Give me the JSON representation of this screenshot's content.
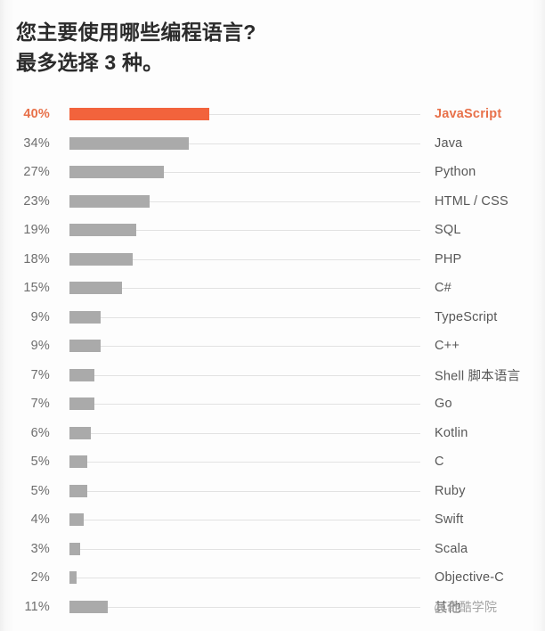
{
  "title": {
    "line1": "您主要使用哪些编程语言?",
    "line2": "最多选择 3 种。"
  },
  "watermark": {
    "text": "@奇酷学院"
  },
  "colors": {
    "highlight": "#f2633c",
    "highlight_text": "#e8714a",
    "bar": "#aaaaaa",
    "track": "#e2e2e2",
    "label": "#575757",
    "pct": "#6e6e6e",
    "title": "#2b2b2b",
    "background": "#fdfdfd"
  },
  "chart_data": {
    "type": "bar",
    "orientation": "horizontal",
    "title": "您主要使用哪些编程语言?最多选择 3 种。",
    "xlabel": "",
    "ylabel": "",
    "xlim": [
      0,
      100
    ],
    "grid": false,
    "legend": null,
    "value_suffix": "%",
    "highlight_category": "JavaScript",
    "categories": [
      "JavaScript",
      "Java",
      "Python",
      "HTML / CSS",
      "SQL",
      "PHP",
      "C#",
      "TypeScript",
      "C++",
      "Shell 脚本语言",
      "Go",
      "Kotlin",
      "C",
      "Ruby",
      "Swift",
      "Scala",
      "Objective-C",
      "其他"
    ],
    "values": [
      40,
      34,
      27,
      23,
      19,
      18,
      15,
      9,
      9,
      7,
      7,
      6,
      5,
      5,
      4,
      3,
      2,
      11
    ],
    "labels": [
      "40%",
      "34%",
      "27%",
      "23%",
      "19%",
      "18%",
      "15%",
      "9%",
      "9%",
      "7%",
      "7%",
      "6%",
      "5%",
      "5%",
      "4%",
      "3%",
      "2%",
      "11%"
    ]
  },
  "rows": [
    {
      "pct": "40%",
      "label": "JavaScript",
      "value": 40,
      "highlight": true
    },
    {
      "pct": "34%",
      "label": "Java",
      "value": 34,
      "highlight": false
    },
    {
      "pct": "27%",
      "label": "Python",
      "value": 27,
      "highlight": false
    },
    {
      "pct": "23%",
      "label": "HTML / CSS",
      "value": 23,
      "highlight": false
    },
    {
      "pct": "19%",
      "label": "SQL",
      "value": 19,
      "highlight": false
    },
    {
      "pct": "18%",
      "label": "PHP",
      "value": 18,
      "highlight": false
    },
    {
      "pct": "15%",
      "label": "C#",
      "value": 15,
      "highlight": false
    },
    {
      "pct": "9%",
      "label": "TypeScript",
      "value": 9,
      "highlight": false
    },
    {
      "pct": "9%",
      "label": "C++",
      "value": 9,
      "highlight": false
    },
    {
      "pct": "7%",
      "label": "Shell 脚本语言",
      "value": 7,
      "highlight": false
    },
    {
      "pct": "7%",
      "label": "Go",
      "value": 7,
      "highlight": false
    },
    {
      "pct": "6%",
      "label": "Kotlin",
      "value": 6,
      "highlight": false
    },
    {
      "pct": "5%",
      "label": "C",
      "value": 5,
      "highlight": false
    },
    {
      "pct": "5%",
      "label": "Ruby",
      "value": 5,
      "highlight": false
    },
    {
      "pct": "4%",
      "label": "Swift",
      "value": 4,
      "highlight": false
    },
    {
      "pct": "3%",
      "label": "Scala",
      "value": 3,
      "highlight": false
    },
    {
      "pct": "2%",
      "label": "Objective-C",
      "value": 2,
      "highlight": false
    },
    {
      "pct": "11%",
      "label": "其他",
      "value": 11,
      "highlight": false
    }
  ]
}
